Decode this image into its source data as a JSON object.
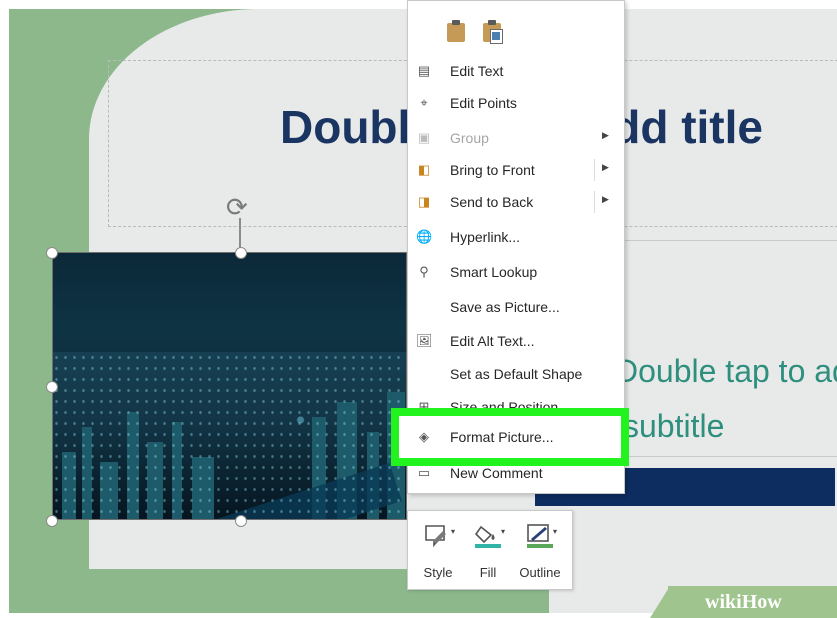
{
  "slide": {
    "title_placeholder": "Double tap to add title",
    "subtitle_line1": "Double tap to add",
    "subtitle_line2": "subtitle"
  },
  "context_menu": {
    "items": [
      {
        "label": "Edit Text",
        "icon": "edit-text-icon",
        "disabled": false,
        "submenu": false
      },
      {
        "label": "Edit Points",
        "icon": "edit-points-icon",
        "disabled": false,
        "submenu": false
      },
      {
        "label": "Group",
        "icon": "group-icon",
        "disabled": true,
        "submenu": true
      },
      {
        "label": "Bring to Front",
        "icon": "bring-to-front-icon",
        "disabled": false,
        "submenu": true
      },
      {
        "label": "Send to Back",
        "icon": "send-to-back-icon",
        "disabled": false,
        "submenu": true
      },
      {
        "label": "Hyperlink...",
        "icon": "hyperlink-icon",
        "disabled": false,
        "submenu": false
      },
      {
        "label": "Smart Lookup",
        "icon": "smart-lookup-icon",
        "disabled": false,
        "submenu": false
      },
      {
        "label": "Save as Picture...",
        "icon": "",
        "disabled": false,
        "submenu": false
      },
      {
        "label": "Edit Alt Text...",
        "icon": "alt-text-icon",
        "disabled": false,
        "submenu": false
      },
      {
        "label": "Set as Default Shape",
        "icon": "",
        "disabled": false,
        "submenu": false
      },
      {
        "label": "Size and Position...",
        "icon": "size-position-icon",
        "disabled": false,
        "submenu": false
      },
      {
        "label": "Format Picture...",
        "icon": "format-picture-icon",
        "disabled": false,
        "submenu": false
      },
      {
        "label": "New Comment",
        "icon": "comment-icon",
        "disabled": false,
        "submenu": false
      }
    ]
  },
  "mini_toolbar": {
    "style_label": "Style",
    "fill_label": "Fill",
    "outline_label": "Outline"
  },
  "watermark": {
    "wiki": "wiki",
    "how": "How"
  },
  "colors": {
    "highlight": "#22f31e",
    "title": "#1b3563",
    "subtitle": "#2e8f7e",
    "slide_green": "#8cb88c"
  }
}
